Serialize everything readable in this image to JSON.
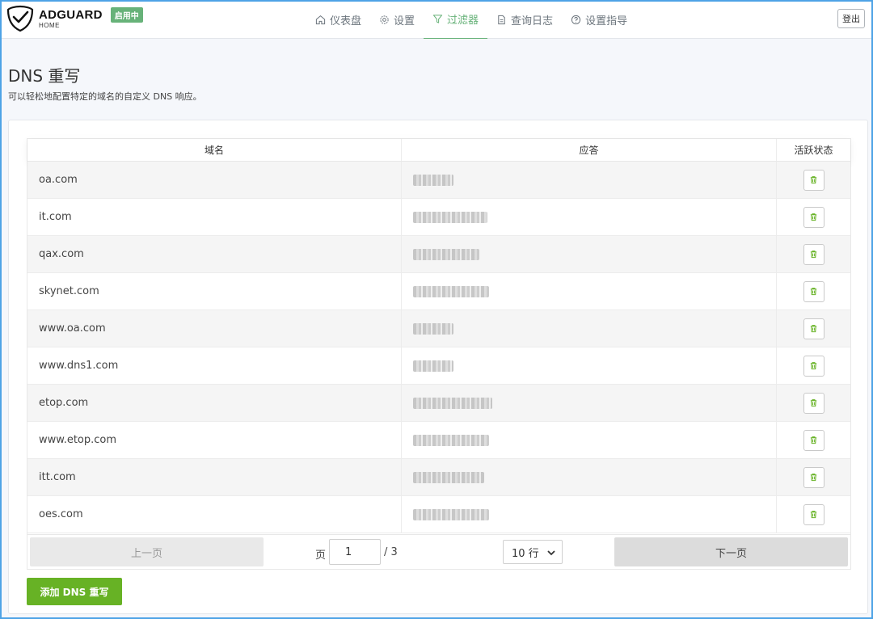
{
  "app": {
    "name": "ADGUARD",
    "subname": "HOME",
    "status": "启用中"
  },
  "nav": [
    {
      "label": "仪表盘",
      "icon": "home-icon"
    },
    {
      "label": "设置",
      "icon": "gear-icon"
    },
    {
      "label": "过滤器",
      "icon": "filter-icon",
      "active": true
    },
    {
      "label": "查询日志",
      "icon": "document-icon"
    },
    {
      "label": "设置指导",
      "icon": "help-icon"
    }
  ],
  "header": {
    "logout_label": "登出"
  },
  "page": {
    "title": "DNS 重写",
    "description": "可以轻松地配置特定的域名的自定义 DNS 响应。"
  },
  "table": {
    "columns": {
      "domain": "域名",
      "answer": "应答",
      "actions": "活跃状态"
    },
    "rows": [
      {
        "domain": "oa.com",
        "answer_redacted": true
      },
      {
        "domain": "it.com",
        "answer_redacted": true
      },
      {
        "domain": "qax.com",
        "answer_redacted": true
      },
      {
        "domain": "skynet.com",
        "answer_redacted": true
      },
      {
        "domain": "www.oa.com",
        "answer_redacted": true
      },
      {
        "domain": "www.dns1.com",
        "answer_redacted": true
      },
      {
        "domain": "etop.com",
        "answer_redacted": true
      },
      {
        "domain": "www.etop.com",
        "answer_redacted": true
      },
      {
        "domain": "itt.com",
        "answer_redacted": true
      },
      {
        "domain": "oes.com",
        "answer_redacted": true
      }
    ]
  },
  "pagination": {
    "prev_label": "上一页",
    "next_label": "下一页",
    "page_label": "页",
    "current_page": "1",
    "total_pages": "/ 3",
    "rows_per_page": "10 行"
  },
  "add_button_label": "添加 DNS 重写",
  "colors": {
    "accent": "#67b279",
    "add_button": "#67b225",
    "frame": "#4ea3e6"
  }
}
